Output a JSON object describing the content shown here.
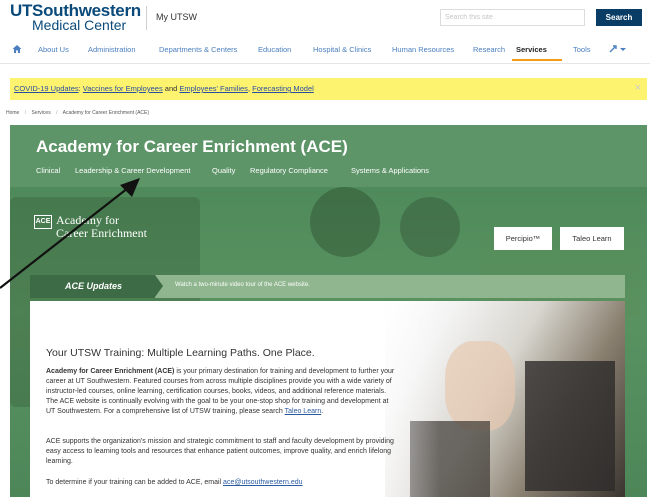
{
  "header": {
    "logo_line1": "UTSouthwestern",
    "logo_line2": "Medical Center",
    "my_utsw": "My UTSW",
    "search_placeholder": "Search this site",
    "search_button": "Search"
  },
  "nav": {
    "items": [
      {
        "label": "About Us"
      },
      {
        "label": "Administration"
      },
      {
        "label": "Departments & Centers"
      },
      {
        "label": "Education"
      },
      {
        "label": "Hospital & Clinics"
      },
      {
        "label": "Human Resources"
      },
      {
        "label": "Research"
      },
      {
        "label": "Services"
      },
      {
        "label": "Tools"
      }
    ],
    "active": "Services"
  },
  "banner": {
    "prefix": "COVID-19 Updates",
    "sep1": ": ",
    "link1": "Vaccines for Employees",
    "sep2": " and ",
    "link2": "Employees' Families",
    "sep3": ", ",
    "link3": "Forecasting Model",
    "close": "×"
  },
  "breadcrumb": [
    "Home",
    "Services",
    "Academy for Career Enrichment (ACE)"
  ],
  "hero": {
    "title": "Academy for Career Enrichment (ACE)",
    "subnav": [
      "Clinical",
      "Leadership & Career Development",
      "Quality",
      "Regulatory Compliance",
      "Systems & Applications"
    ],
    "ace_box": "ACE",
    "ace_logo_line1": "Academy for",
    "ace_logo_line2": "Career Enrichment",
    "btn_percipio": "Percipio™",
    "btn_taleo": "Taleo Learn"
  },
  "updates": {
    "tab": "ACE Updates",
    "message": "Watch a two-minute video tour of the ACE website."
  },
  "panel": {
    "heading": "Your UTSW Training: Multiple Learning Paths. One Place.",
    "p1_bold": "Academy for Career Enrichment (ACE)",
    "p1_rest": " is your primary destination for training and development to further your career at UT Southwestern. Featured courses from across multiple disciplines provide you with a wide variety of instructor-led courses, online learning, certification courses, books, videos, and additional reference materials. The ACE website is continually evolving with the goal to be your one-stop shop for training and development at UT Southwestern. For a comprehensive list of UTSW training, please search ",
    "p1_link": "Taleo Learn",
    "p1_end": ".",
    "p2": "ACE supports the organization's mission and strategic commitment to staff and faculty development by providing easy access to learning tools and resources that enhance patient outcomes, improve quality, and enrich lifelong learning.",
    "p3": "To determine if your training can be added to ACE, email ",
    "p3_link": "ace@utsouthwestern.edu"
  },
  "colors": {
    "brand_blue": "#0a4a7a",
    "hero_green": "#5d9468",
    "banner_yellow": "#fef36e",
    "active_underline": "#f39c12"
  }
}
